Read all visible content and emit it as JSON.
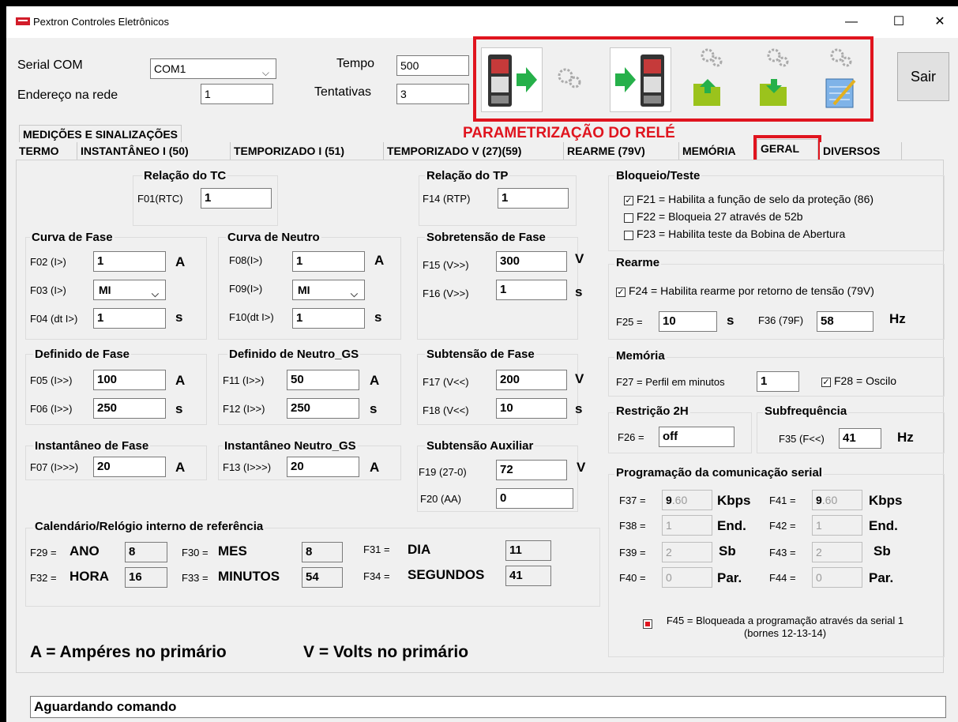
{
  "window": {
    "title": "Pextron Controles Eletrônicos",
    "minimize": "—",
    "maximize": "☐",
    "close": "✕"
  },
  "conn": {
    "serial_label": "Serial COM",
    "serial_value": "COM1",
    "endereco_label": "Endereço na rede",
    "endereco_value": "1",
    "tempo_label": "Tempo",
    "tempo_value": "500",
    "tentativas_label": "Tentativas",
    "tentativas_value": "3"
  },
  "toolbar": {
    "section_label": "PARAMETRIZAÇÃO DO RELÉ",
    "sair": "Sair"
  },
  "tab_top": "MEDIÇÕES E SINALIZAÇÕES",
  "tabs": [
    "TERMO",
    "INSTANTÂNEO I (50)",
    "TEMPORIZADO I (51)",
    "TEMPORIZADO V (27)(59)",
    "REARME (79V)",
    "MEMÓRIA",
    "GERAL",
    "DIVERSOS"
  ],
  "tc": {
    "title": "Relação do TC",
    "label": "F01(RTC)",
    "value": "1"
  },
  "tp": {
    "title": "Relação do TP",
    "label": "F14 (RTP)",
    "value": "1"
  },
  "curva_fase": {
    "title": "Curva de Fase",
    "f02_label": "F02 (I>)",
    "f02": "1",
    "f02_unit": "A",
    "f03_label": "F03 (I>)",
    "f03": "MI",
    "f04_label": "F04 (dt I>)",
    "f04": "1",
    "f04_unit": "s"
  },
  "curva_neutro": {
    "title": "Curva de Neutro",
    "f08_label": "F08(I>)",
    "f08": "1",
    "f08_unit": "A",
    "f09_label": "F09(I>)",
    "f09": "MI",
    "f10_label": "F10(dt I>)",
    "f10": "1",
    "f10_unit": "s"
  },
  "sobretensao": {
    "title": "Sobretensão de Fase",
    "f15_label": "F15 (V>>)",
    "f15": "300",
    "f15_unit": "V",
    "f16_label": "F16 (V>>)",
    "f16": "1",
    "f16_unit": "s"
  },
  "def_fase": {
    "title": "Definido de Fase",
    "f05_label": "F05 (I>>)",
    "f05": "100",
    "f05_unit": "A",
    "f06_label": "F06 (I>>)",
    "f06": "250",
    "f06_unit": "s"
  },
  "def_neutro": {
    "title": "Definido de Neutro_GS",
    "f11_label": "F11 (I>>)",
    "f11": "50",
    "f11_unit": "A",
    "f12_label": "F12 (I>>)",
    "f12": "250",
    "f12_unit": "s"
  },
  "subtensao": {
    "title": "Subtensão de Fase",
    "f17_label": "F17 (V<<)",
    "f17": "200",
    "f17_unit": "V",
    "f18_label": "F18 (V<<)",
    "f18": "10",
    "f18_unit": "s"
  },
  "inst_fase": {
    "title": "Instantâneo de Fase",
    "f07_label": "F07 (I>>>)",
    "f07": "20",
    "f07_unit": "A"
  },
  "inst_neutro": {
    "title": "Instantâneo Neutro_GS",
    "f13_label": "F13 (I>>>)",
    "f13": "20",
    "f13_unit": "A"
  },
  "sub_aux": {
    "title": "Subtensão Auxiliar",
    "f19_label": "F19 (27-0)",
    "f19": "72",
    "f19_unit": "V",
    "f20_label": "F20 (AA)",
    "f20": "0"
  },
  "calendario": {
    "title": "Calendário/Relógio interno de referência",
    "f29": "F29 =",
    "ano": "ANO",
    "ano_v": "8",
    "f30": "F30 =",
    "mes": "MES",
    "mes_v": "8",
    "f31": "F31 =",
    "dia": "DIA",
    "dia_v": "11",
    "f32": "F32 =",
    "hora": "HORA",
    "hora_v": "16",
    "f33": "F33 =",
    "min": "MINUTOS",
    "min_v": "54",
    "f34": "F34 =",
    "seg": "SEGUNDOS",
    "seg_v": "41"
  },
  "legend": {
    "a": "A = Ampéres no primário",
    "v": "V = Volts no primário"
  },
  "bloqueio": {
    "title": "Bloqueio/Teste",
    "f21": "F21 = Habilita a função de selo da proteção (86)",
    "f22": "F22 = Bloqueia 27 através de 52b",
    "f23": "F23 = Habilita teste da Bobina de Abertura"
  },
  "rearme": {
    "title": "Rearme",
    "f24": "F24 = Habilita rearme por retorno de tensão (79V)",
    "f25_label": "F25 =",
    "f25": "10",
    "f25_unit": "s",
    "f36_label": "F36 (79F)",
    "f36": "58",
    "f36_unit": "Hz"
  },
  "memoria": {
    "title": "Memória",
    "f27_label": "F27 = Perfil em minutos",
    "f27": "1",
    "f28": "F28 = Oscilo"
  },
  "restricao": {
    "title": "Restrição 2H",
    "f26_label": "F26 =",
    "f26": "off"
  },
  "subfreq": {
    "title": "Subfrequência",
    "f35_label": "F35 (F<<)",
    "f35": "41",
    "f35_unit": "Hz"
  },
  "serial": {
    "title": "Programação da comunicação serial",
    "f37": "F37 =",
    "f37_v": "9",
    "f37_v2": ".60",
    "f37_u": "Kbps",
    "f41": "F41 =",
    "f41_v": "9",
    "f41_v2": ".60",
    "f41_u": "Kbps",
    "f38": "F38 =",
    "f38_v": "1",
    "f38_u": "End.",
    "f42": "F42 =",
    "f42_v": "1",
    "f42_u": "End.",
    "f39": "F39 =",
    "f39_v": "2",
    "f39_u": "Sb",
    "f43": "F43 =",
    "f43_v": "2",
    "f43_u": "Sb",
    "f40": "F40 =",
    "f40_v": "0",
    "f40_u": "Par.",
    "f44": "F44 =",
    "f44_v": "0",
    "f44_u": "Par.",
    "f45": "F45 = Bloqueada a programação através da serial 1 (bornes 12-13-14)"
  },
  "status": "Aguardando comando",
  "colors": {
    "accent_red": "#e0141e",
    "folder": "#9bc31c",
    "arrow": "#26b04a"
  }
}
